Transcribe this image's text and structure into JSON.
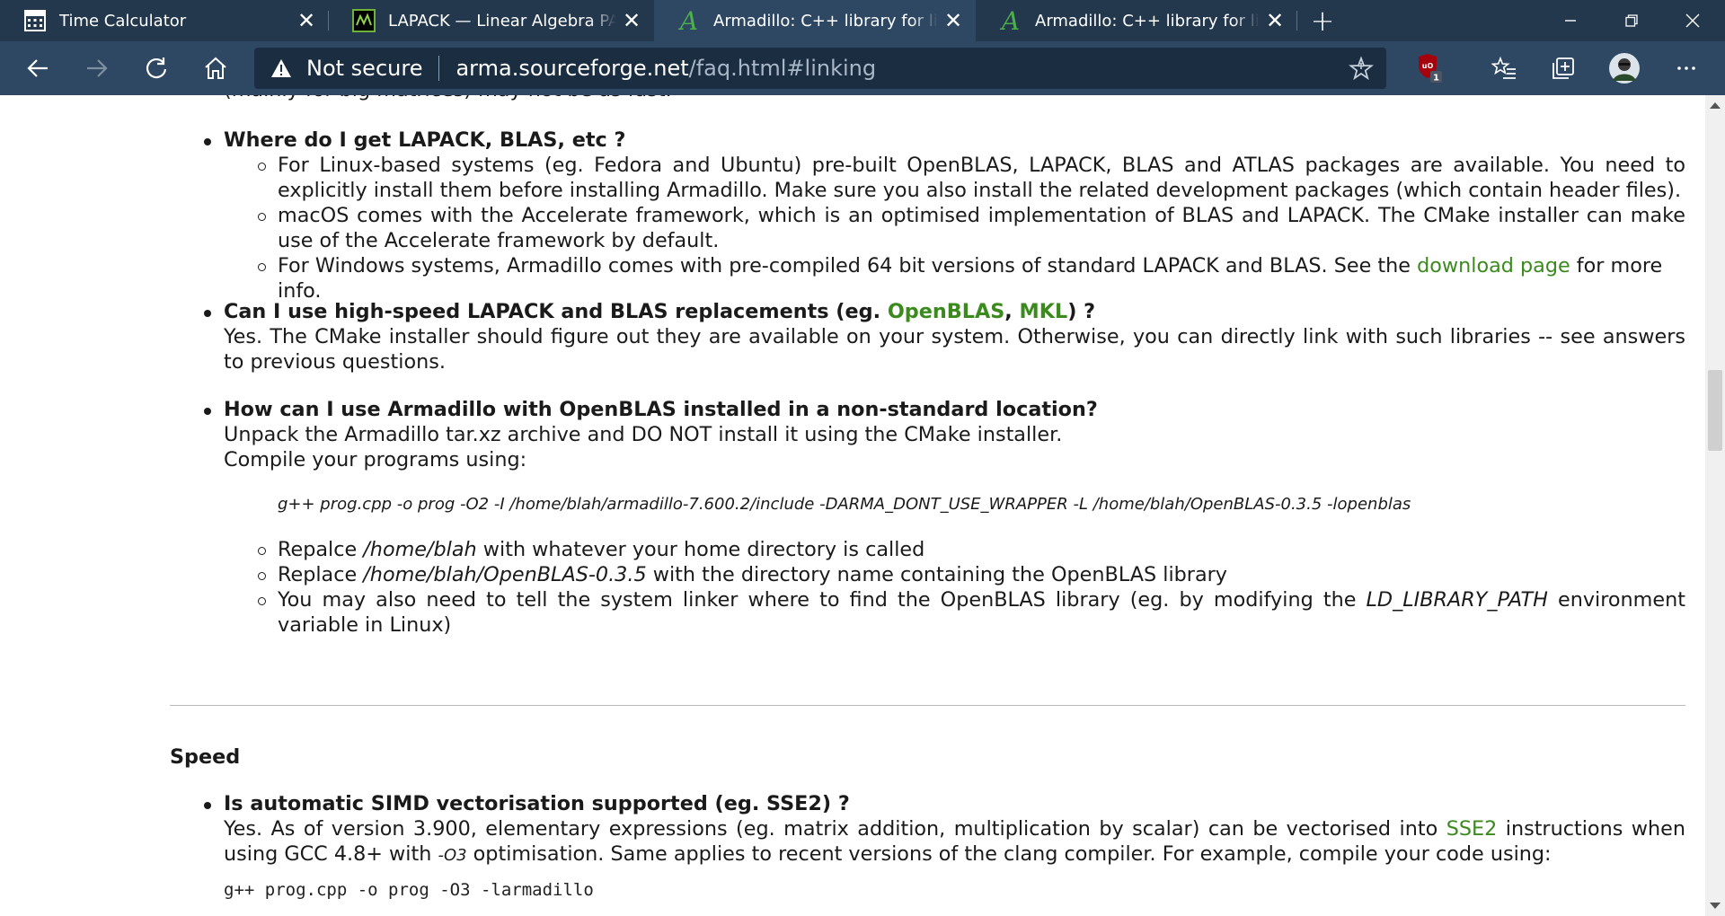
{
  "browser": {
    "tabs": [
      {
        "title": "Time Calculator",
        "icon": "calculator-icon"
      },
      {
        "title": "LAPACK — Linear Algebra PACKage",
        "icon": "lapack-logo-icon"
      },
      {
        "title": "Armadillo: C++ library for linear algebra",
        "icon": "armadillo-logo-icon",
        "active": true
      },
      {
        "title": "Armadillo: C++ library for linear algebra",
        "icon": "armadillo-logo-icon"
      }
    ],
    "address": {
      "security_label": "Not secure",
      "host": "arma.sourceforge.net",
      "path": "/faq.html#linking"
    },
    "extension_badge": "1",
    "colors": {
      "tabstrip": "#23374d",
      "toolbar": "#2e4863",
      "link": "#3b8a1e"
    }
  },
  "page": {
    "cut_line": "(mainly for big matrices) may not be as fast.",
    "faq": [
      {
        "question": "Where do I get LAPACK, BLAS, etc ?",
        "subs": [
          "For Linux-based systems (eg. Fedora and Ubuntu) pre-built OpenBLAS, LAPACK, BLAS and ATLAS packages are available. You need to explicitly install them before installing Armadillo. Make sure you also install the related development packages (which contain header files).",
          "macOS comes with the Accelerate framework, which is an optimised implementation of BLAS and LAPACK. The CMake installer can make use of the Accelerate framework by default."
        ],
        "sub3_pre": "For Windows systems, Armadillo comes with pre-compiled 64 bit versions of standard LAPACK and BLAS. See the ",
        "sub3_link": "download page",
        "sub3_post": " for more info."
      },
      {
        "question_pre": "Can I use high-speed LAPACK and BLAS replacements (eg. ",
        "link1": "OpenBLAS",
        "sep": ", ",
        "link2": "MKL",
        "question_post": ") ?",
        "answer": "Yes. The CMake installer should figure out they are available on your system. Otherwise, you can directly link with such libraries -- see answers to previous questions."
      },
      {
        "question": "How can I use Armadillo with OpenBLAS installed in a non-standard location?",
        "answer_line1": "Unpack the Armadillo tar.xz archive and DO NOT install it using the CMake installer.",
        "answer_line2": "Compile your programs using:",
        "code": "g++ prog.cpp -o prog -O2 -I /home/blah/armadillo-7.600.2/include -DARMA_DONT_USE_WRAPPER -L /home/blah/OpenBLAS-0.3.5 -lopenblas",
        "s1_pre": "Repalce ",
        "s1_it": "/home/blah",
        "s1_post": " with whatever your home directory is called",
        "s2_pre": "Replace ",
        "s2_it": "/home/blah/OpenBLAS-0.3.5",
        "s2_post": " with the directory name containing the OpenBLAS library",
        "s3_pre": "You may also need to tell the system linker where to find the OpenBLAS library (eg. by modifying the ",
        "s3_it": "LD_LIBRARY_PATH",
        "s3_post": " environment variable in Linux)"
      }
    ],
    "section_title": "Speed",
    "speed": {
      "question": "Is automatic SIMD vectorisation supported (eg. SSE2) ?",
      "a_pre": "Yes. As of version 3.900, elementary expressions (eg. matrix addition, multiplication by scalar) can be vectorised into ",
      "a_link": "SSE2",
      "a_mid": " instructions when using GCC 4.8+ with ",
      "a_it": "-O3",
      "a_post": " optimisation. Same applies to recent versions of the clang compiler. For example, compile your code using:",
      "code": "g++ prog.cpp -o prog -O3 -larmadillo"
    }
  }
}
